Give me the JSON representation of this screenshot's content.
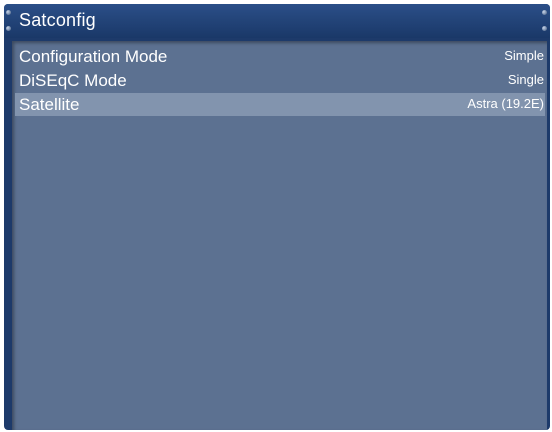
{
  "window": {
    "title": "Satconfig"
  },
  "settings": [
    {
      "label": "Configuration Mode",
      "value": "Simple"
    },
    {
      "label": "DiSEqC Mode",
      "value": "Single"
    },
    {
      "label": "Satellite",
      "value": "Astra (19.2E)",
      "selected": true
    }
  ],
  "colors": {
    "window_frame": "#1d3a6a",
    "content_background": "#5c7191",
    "selected_row": "#8294ae",
    "text": "#ffffff"
  }
}
